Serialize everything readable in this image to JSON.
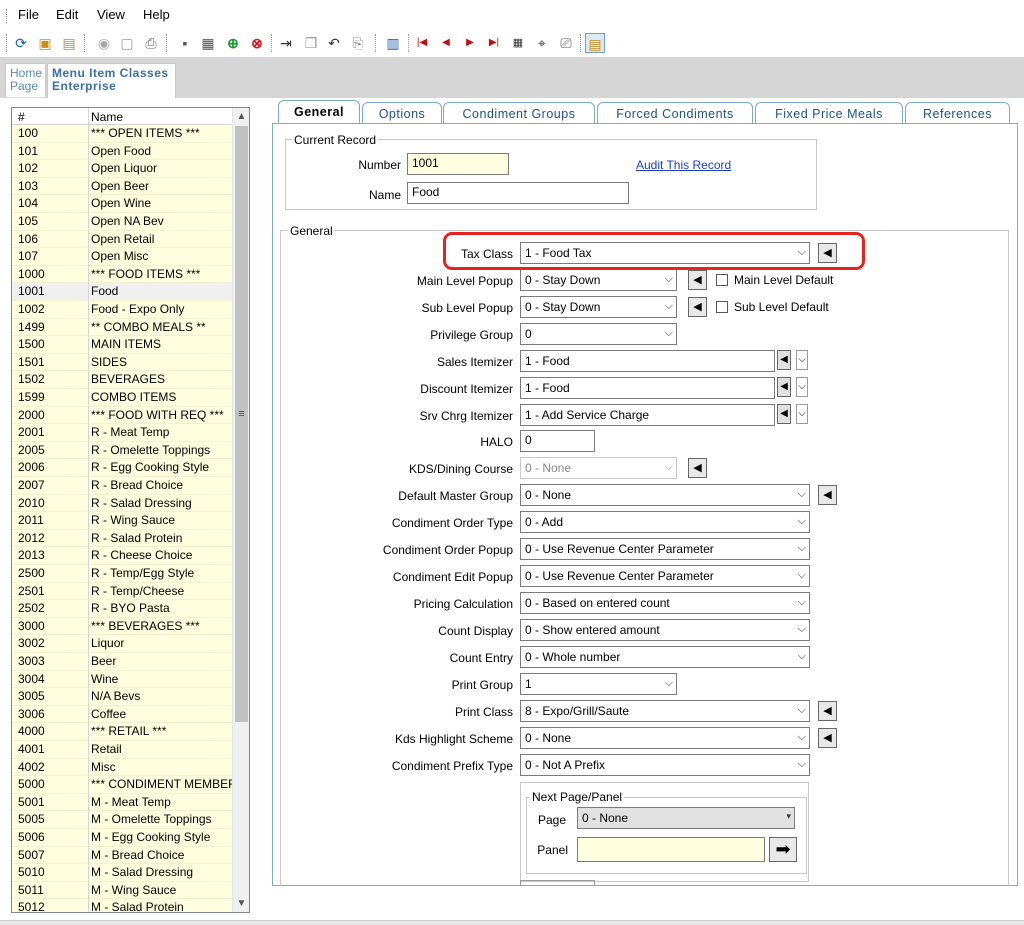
{
  "menu": {
    "file": "File",
    "edit": "Edit",
    "view": "View",
    "help": "Help"
  },
  "toolbar": {
    "icons": [
      "refresh-icon",
      "new-record-icon",
      "new-copy-icon",
      "circle-icon",
      "report-icon",
      "print-icon",
      "save-icon",
      "save-all-icon",
      "add-icon",
      "delete-icon",
      "insert-icon",
      "copy-icon",
      "undo-icon",
      "paste-icon",
      "swap-icon",
      "first-icon",
      "prev-icon",
      "next-icon",
      "last-icon",
      "goto-icon",
      "binoculars-icon",
      "find-icon",
      "table-view-icon"
    ]
  },
  "page_tabs": {
    "home_line1": "Home",
    "home_line2": "Page",
    "menu_line1": "Menu Item Classes",
    "menu_line2": "Enterprise"
  },
  "grid": {
    "col_num": "#",
    "col_name": "Name",
    "selected_index": 11,
    "rows": [
      {
        "num": "100",
        "name": "*** OPEN ITEMS ***"
      },
      {
        "num": "101",
        "name": "Open Food"
      },
      {
        "num": "102",
        "name": "Open Liquor"
      },
      {
        "num": "103",
        "name": "Open Beer"
      },
      {
        "num": "104",
        "name": "Open Wine"
      },
      {
        "num": "105",
        "name": "Open NA Bev"
      },
      {
        "num": "106",
        "name": "Open Retail"
      },
      {
        "num": "107",
        "name": "Open Misc"
      },
      {
        "num": "1000",
        "name": "*** FOOD ITEMS ***"
      },
      {
        "num": "1001",
        "name": "Food"
      },
      {
        "num": "1002",
        "name": "Food - Expo Only"
      },
      {
        "num": "1499",
        "name": "** COMBO MEALS **"
      },
      {
        "num": "1500",
        "name": "MAIN ITEMS"
      },
      {
        "num": "1501",
        "name": "SIDES"
      },
      {
        "num": "1502",
        "name": "BEVERAGES"
      },
      {
        "num": "1599",
        "name": "COMBO ITEMS"
      },
      {
        "num": "2000",
        "name": "*** FOOD WITH REQ ***"
      },
      {
        "num": "2001",
        "name": "R - Meat Temp"
      },
      {
        "num": "2005",
        "name": "R - Omelette Toppings"
      },
      {
        "num": "2006",
        "name": "R - Egg Cooking Style"
      },
      {
        "num": "2007",
        "name": "R - Bread Choice"
      },
      {
        "num": "2010",
        "name": "R - Salad Dressing"
      },
      {
        "num": "2011",
        "name": "R - Wing Sauce"
      },
      {
        "num": "2012",
        "name": "R - Salad Protein"
      },
      {
        "num": "2013",
        "name": "R - Cheese Choice"
      },
      {
        "num": "2500",
        "name": "R - Temp/Egg Style"
      },
      {
        "num": "2501",
        "name": "R - Temp/Cheese"
      },
      {
        "num": "2502",
        "name": "R - BYO Pasta"
      },
      {
        "num": "3000",
        "name": "*** BEVERAGES ***"
      },
      {
        "num": "3002",
        "name": "Liquor"
      },
      {
        "num": "3003",
        "name": "Beer"
      },
      {
        "num": "3004",
        "name": "Wine"
      },
      {
        "num": "3005",
        "name": "N/A Bevs"
      },
      {
        "num": "3006",
        "name": "Coffee"
      },
      {
        "num": "4000",
        "name": "*** RETAIL ***"
      },
      {
        "num": "4001",
        "name": "Retail"
      },
      {
        "num": "4002",
        "name": "Misc"
      },
      {
        "num": "5000",
        "name": "*** CONDIMENT MEMBER *"
      },
      {
        "num": "5001",
        "name": "M - Meat Temp"
      },
      {
        "num": "5005",
        "name": "M - Omelette Toppings"
      },
      {
        "num": "5006",
        "name": "M - Egg Cooking Style"
      },
      {
        "num": "5007",
        "name": "M - Bread Choice"
      },
      {
        "num": "5010",
        "name": "M - Salad Dressing"
      },
      {
        "num": "5011",
        "name": "M - Wing Sauce"
      },
      {
        "num": "5012",
        "name": "M - Salad Protein"
      }
    ]
  },
  "detail_tabs": {
    "general": "General",
    "options": "Options",
    "condiment_groups": "Condiment Groups",
    "forced_condiments": "Forced Condiments",
    "fixed_price_meals": "Fixed Price Meals",
    "references": "References"
  },
  "current_record": {
    "legend": "Current Record",
    "number_label": "Number",
    "number_value": "1001",
    "name_label": "Name",
    "name_value": "Food",
    "audit_link": "Audit This Record"
  },
  "general": {
    "legend": "General",
    "tax_class": {
      "label": "Tax Class",
      "value": "1 - Food Tax"
    },
    "main_level_popup": {
      "label": "Main Level Popup",
      "value": "0 - Stay Down",
      "default_label": "Main Level Default"
    },
    "sub_level_popup": {
      "label": "Sub Level Popup",
      "value": "0 - Stay Down",
      "default_label": "Sub Level Default"
    },
    "privilege_group": {
      "label": "Privilege Group",
      "value": "0"
    },
    "sales_itemizer": {
      "label": "Sales Itemizer",
      "value": "1 - Food"
    },
    "discount_itemizer": {
      "label": "Discount Itemizer",
      "value": "1 - Food"
    },
    "srv_chrg_itemizer": {
      "label": "Srv Chrg Itemizer",
      "value": "1 - Add Service Charge"
    },
    "halo": {
      "label": "HALO",
      "value": "0"
    },
    "kds_dining_course": {
      "label": "KDS/Dining Course",
      "value": "0 - None"
    },
    "default_master_group": {
      "label": "Default Master Group",
      "value": "0 - None"
    },
    "condiment_order_type": {
      "label": "Condiment Order Type",
      "value": "0 - Add"
    },
    "condiment_order_popup": {
      "label": "Condiment Order Popup",
      "value": "0 - Use Revenue Center Parameter"
    },
    "condiment_edit_popup": {
      "label": "Condiment Edit Popup",
      "value": "0 - Use Revenue Center Parameter"
    },
    "pricing_calculation": {
      "label": "Pricing Calculation",
      "value": "0 - Based on entered count"
    },
    "count_display": {
      "label": "Count Display",
      "value": "0 - Show entered amount"
    },
    "count_entry": {
      "label": "Count Entry",
      "value": "0 - Whole number"
    },
    "print_group": {
      "label": "Print Group",
      "value": "1"
    },
    "print_class": {
      "label": "Print Class",
      "value": "8 - Expo/Grill/Saute"
    },
    "kds_highlight_scheme": {
      "label": "Kds Highlight Scheme",
      "value": "0 - None"
    },
    "condiment_prefix_type": {
      "label": "Condiment Prefix Type",
      "value": "0 - Not A Prefix"
    }
  },
  "next_page_panel": {
    "legend": "Next Page/Panel",
    "page_label": "Page",
    "page_value": "0 - None",
    "panel_label": "Panel",
    "panel_value": ""
  }
}
